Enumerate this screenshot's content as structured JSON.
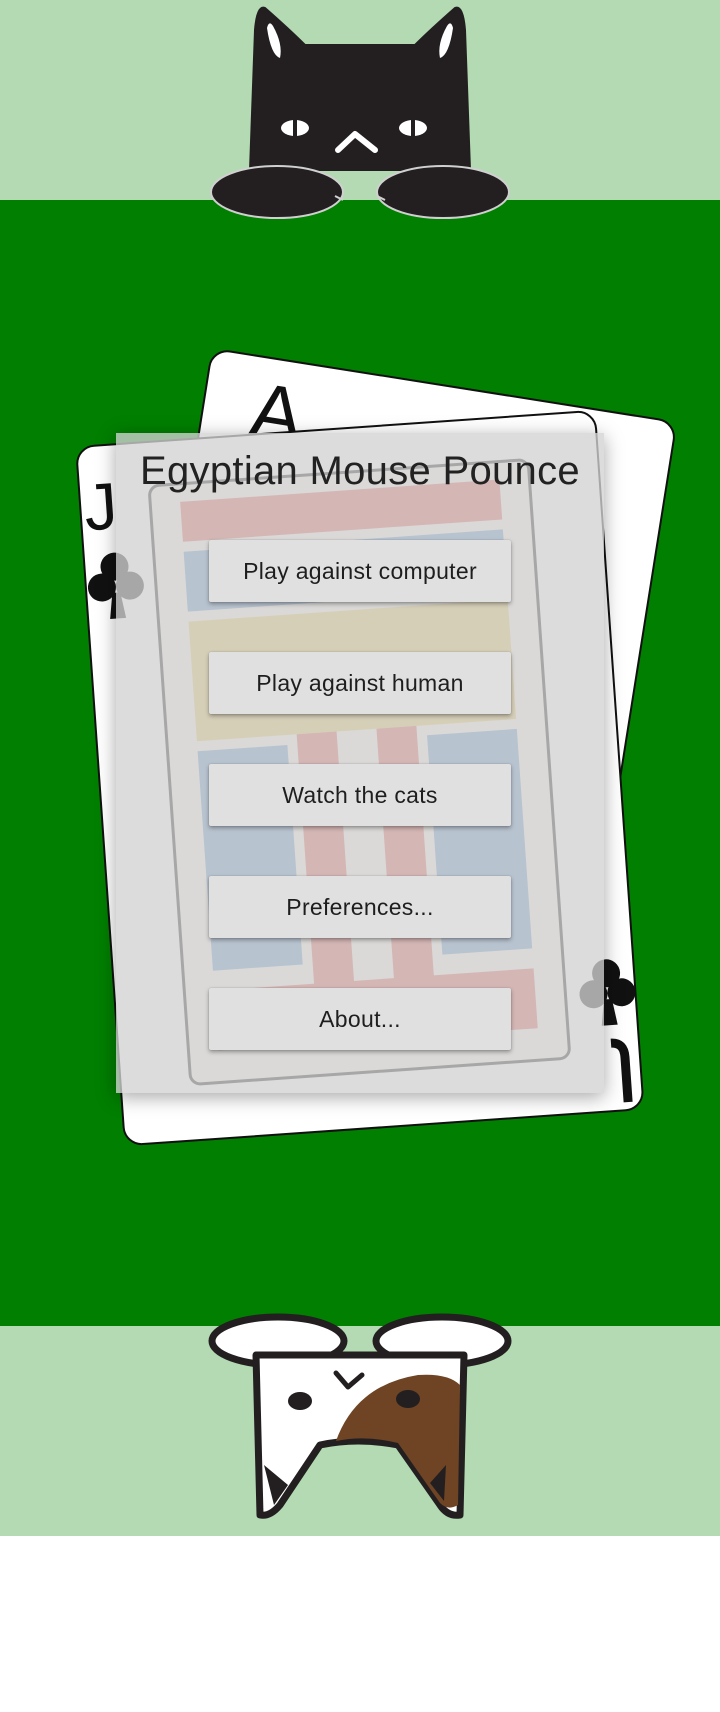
{
  "app": {
    "title": "Egyptian Mouse Pounce"
  },
  "menu": {
    "buttons": [
      {
        "label": "Play against computer"
      },
      {
        "label": "Play against human"
      },
      {
        "label": "Watch the cats"
      },
      {
        "label": "Preferences..."
      },
      {
        "label": "About..."
      }
    ]
  },
  "cards": {
    "back_card_rank": "A",
    "front_card_rank": "J",
    "front_card_suit": "clubs"
  },
  "colors": {
    "table_green": "#007f00",
    "band_light_green": "#b3dab3",
    "panel_gray": "#d2d2d2",
    "button_gray": "#e0e0e0",
    "cat_black": "#231f20",
    "cat_brown_patch": "#6f4424"
  },
  "icons": {
    "top_player": "black-cat-icon",
    "bottom_player": "brown-white-cat-icon"
  }
}
